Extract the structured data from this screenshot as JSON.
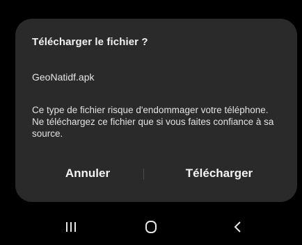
{
  "dialog": {
    "title": "Télécharger le fichier ?",
    "file_name": "GeoNatidf.apk",
    "message": "Ce type de fichier risque d'endommager votre téléphone. Ne téléchargez ce fichier que si vous faites confiance à sa source.",
    "cancel_label": "Annuler",
    "download_label": "Télécharger"
  },
  "nav_bar": {
    "recents_icon": "recents-icon",
    "home_icon": "home-icon",
    "back_icon": "back-icon"
  },
  "colors": {
    "background": "#000000",
    "dialog_background": "#2a2a2a",
    "text": "#f2f2f2"
  }
}
